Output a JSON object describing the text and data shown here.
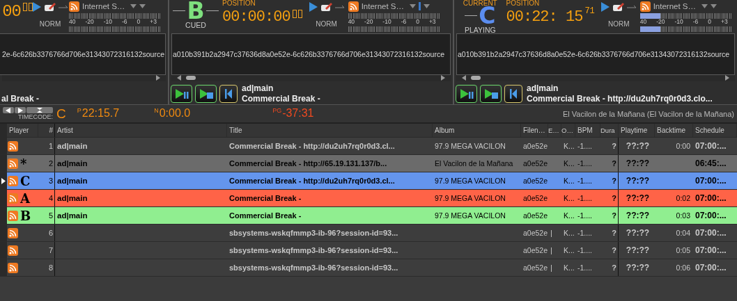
{
  "decks": [
    {
      "time": "00",
      "mode": "NORM",
      "source": "Internet S…",
      "marker": false,
      "scale": [
        "40",
        "-20",
        "-10",
        "-6",
        "0",
        "+3"
      ],
      "text": "2e-6c626b3376766d706e31343072316132source",
      "title": "al Break -"
    },
    {
      "letter": "B",
      "color": "#7ee07e",
      "state": "CUED",
      "position_label": "POSITION",
      "time": "00:00:00",
      "mode": "NORM",
      "source": "Internet S…",
      "marker": true,
      "scale": [
        "40",
        "-20",
        "-10",
        "-6",
        "0",
        "+3"
      ],
      "text": "a010b391b2a2947c37636d8a0e52e-6c626b3376766d706e31343072316132source",
      "artist": "ad|main",
      "title": "Commercial Break -"
    },
    {
      "top_label": "CURRENT",
      "letter": "C",
      "color": "#5b8def",
      "state": "PLAYING",
      "position_label": "POSITION",
      "time": "00:22: 15",
      "frames": "71",
      "mode": "NORM",
      "source": "Internet S…",
      "marker": false,
      "meter": {
        "level": 0.22
      },
      "scale": [
        "40",
        "-20",
        "-10",
        "-6",
        "0",
        "+3"
      ],
      "text": "a010b391b2a2947c37636d8a0e52e-6c626b3376766d706e31343072316132source",
      "artist": "ad|main",
      "title": "Commercial Break - http://du2uh7rq0r0d3.clo..."
    }
  ],
  "timecode": {
    "label": "TIMECODE:",
    "player": "C",
    "p_label": "P",
    "p_time": "22:15.7",
    "n_label": "N",
    "n_time": "0:00.0",
    "pg_label": "PG",
    "pg_time": "-37:31",
    "show": "El Vacilon de la Mañana (El Vacilon de la Mañana)"
  },
  "table": {
    "columns": [
      "Player",
      "#",
      "Artist",
      "Title",
      "Album",
      "Filen…",
      "E…",
      "O…",
      "BPM",
      "Dura",
      "Playtime",
      "Backtime",
      "Schedule"
    ],
    "rows": [
      {
        "player": "",
        "num": "1",
        "artist": "ad|main",
        "title": "Commercial Break - http://du2uh7rq0r0d3.cl...",
        "album": "97.9 MEGA VACILON",
        "filename": "a0e52e",
        "e": "",
        "o": "K...",
        "bpm": "-1....",
        "duration": "?",
        "playtime": "??:??",
        "backtime": "0:00",
        "schedule": "07:00:...",
        "current": false
      },
      {
        "player": "*",
        "num": "2",
        "artist": "ad|main",
        "title": "Commercial Break - http://65.19.131.137/b...",
        "album": "El Vacilon de la Mañana",
        "filename": "a0e52e",
        "e": "",
        "o": "K...",
        "bpm": "-1....",
        "duration": "?",
        "playtime": "??:??",
        "backtime": "",
        "schedule": "06:45:...",
        "color": "#6b6b6b",
        "current": false
      },
      {
        "player": "C",
        "num": "3",
        "artist": "ad|main",
        "title": "Commercial Break - http://du2uh7rq0r0d3.cl...",
        "album": "97.9 MEGA VACILON",
        "filename": "a0e52e",
        "e": "",
        "o": "K...",
        "bpm": "-1....",
        "duration": "?",
        "playtime": "??:??",
        "backtime": "",
        "schedule": "07:00:...",
        "color": "#6495ed",
        "current": true
      },
      {
        "player": "A",
        "num": "4",
        "artist": "ad|main",
        "title": "Commercial Break -",
        "album": "97.9 MEGA VACILON",
        "filename": "a0e52e",
        "e": "",
        "o": "K...",
        "bpm": "-1....",
        "duration": "?",
        "playtime": "??:??",
        "backtime": "0:02",
        "schedule": "07:00:...",
        "color": "#ff6347",
        "current": false
      },
      {
        "player": "B",
        "num": "5",
        "artist": "ad|main",
        "title": "Commercial Break -",
        "album": "97.9 MEGA VACILON",
        "filename": "a0e52e",
        "e": "",
        "o": "K...",
        "bpm": "-1....",
        "duration": "?",
        "playtime": "??:??",
        "backtime": "0:03",
        "schedule": "07:00:...",
        "color": "#90ee90",
        "current": false
      },
      {
        "player": "",
        "num": "6",
        "artist": "",
        "title": "sbsystems-wskqfmmp3-ib-96?session-id=93...",
        "album": "",
        "filename": "a0e52e",
        "e": "|",
        "o": "K...",
        "bpm": "-1....",
        "duration": "?",
        "playtime": "??:??",
        "backtime": "0:04",
        "schedule": "07:00:...",
        "current": false
      },
      {
        "player": "",
        "num": "7",
        "artist": "",
        "title": "sbsystems-wskqfmmp3-ib-96?session-id=93...",
        "album": "",
        "filename": "a0e52e",
        "e": "|",
        "o": "K...",
        "bpm": "-1....",
        "duration": "?",
        "playtime": "??:??",
        "backtime": "0:05",
        "schedule": "07:00:...",
        "current": false
      },
      {
        "player": "",
        "num": "8",
        "artist": "",
        "title": "sbsystems-wskqfmmp3-ib-96?session-id=93...",
        "album": "",
        "filename": "a0e52e",
        "e": "|",
        "o": "K...",
        "bpm": "-1....",
        "duration": "?",
        "playtime": "??:??",
        "backtime": "0:06",
        "schedule": "07:00:...",
        "current": false
      }
    ]
  }
}
